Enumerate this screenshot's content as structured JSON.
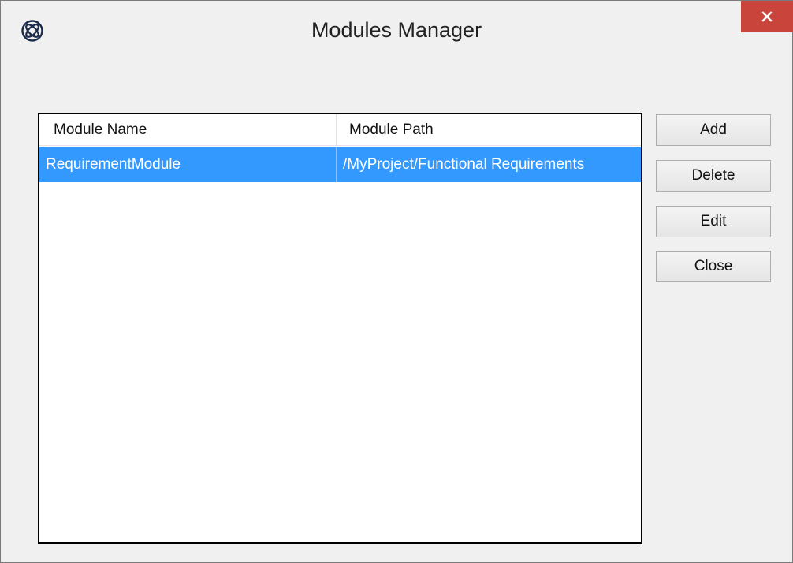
{
  "window": {
    "title": "Modules Manager",
    "app_icon": "enterprise-architect-logo-icon",
    "close_icon": "close-icon"
  },
  "table": {
    "columns": [
      "Module Name",
      "Module Path"
    ],
    "rows": [
      {
        "name": "RequirementModule",
        "path": "/MyProject/Functional Requirements",
        "selected": true
      }
    ]
  },
  "buttons": {
    "add": "Add",
    "delete": "Delete",
    "edit": "Edit",
    "close": "Close"
  },
  "colors": {
    "selection": "#3399ff",
    "close_button": "#c9453b"
  }
}
